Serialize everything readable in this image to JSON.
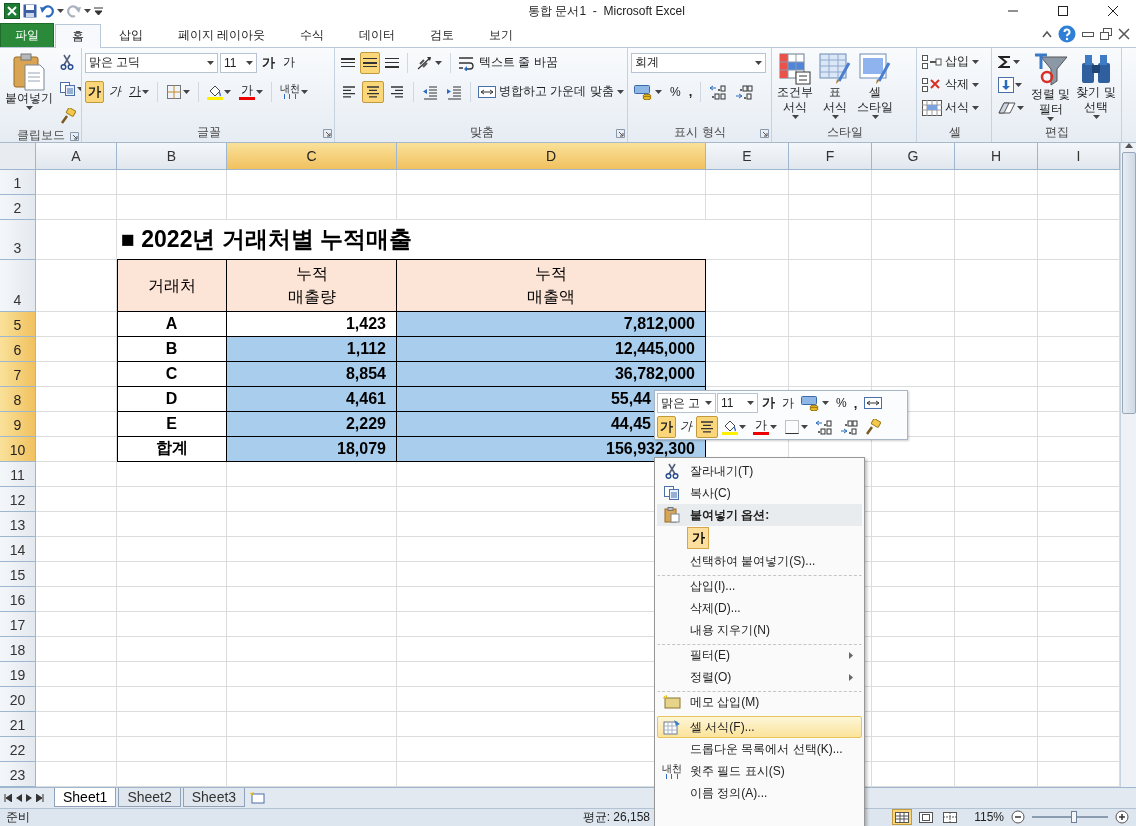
{
  "window": {
    "title": "통합 문서1  -  Microsoft Excel"
  },
  "ribbon_tabs": [
    {
      "label": "파일",
      "kind": "file",
      "selected": false
    },
    {
      "label": "홈",
      "kind": "tab",
      "selected": true
    },
    {
      "label": "삽입",
      "kind": "tab",
      "selected": false
    },
    {
      "label": "페이지 레이아웃",
      "kind": "tab",
      "selected": false
    },
    {
      "label": "수식",
      "kind": "tab",
      "selected": false
    },
    {
      "label": "데이터",
      "kind": "tab",
      "selected": false
    },
    {
      "label": "검토",
      "kind": "tab",
      "selected": false
    },
    {
      "label": "보기",
      "kind": "tab",
      "selected": false
    }
  ],
  "ribbon": {
    "clipboard": {
      "label": "클립보드",
      "paste": "붙여넣기"
    },
    "font": {
      "label": "글꼴",
      "font_name": "맑은 고딕",
      "font_size": "11",
      "grow": "가",
      "shrink": "가",
      "bold": {
        "text": "가",
        "selected": true
      },
      "italic": {
        "text": "가",
        "selected": false
      },
      "underline": {
        "text": "가",
        "selected": false
      },
      "font_color": "가",
      "phonetic": "내천"
    },
    "alignment": {
      "label": "맞춤",
      "vertical": [
        {
          "selected": false
        },
        {
          "selected": true
        },
        {
          "selected": false
        }
      ],
      "horizontal": [
        {
          "selected": false
        },
        {
          "selected": true
        },
        {
          "selected": false
        }
      ],
      "wrap_text": "텍스트 줄 바꿈",
      "merge": "병합하고 가운데 맞춤"
    },
    "number": {
      "label": "표시 형식",
      "format": "회계",
      "percent": "%",
      "comma": ","
    },
    "styles": {
      "label": "스타일",
      "buttons": [
        {
          "label": "조건부\n서식"
        },
        {
          "label": "표\n서식"
        },
        {
          "label": "셀\n스타일"
        }
      ]
    },
    "cells": {
      "label": "셀",
      "buttons": [
        {
          "label": "삽입"
        },
        {
          "label": "삭제"
        },
        {
          "label": "서식"
        }
      ]
    },
    "editing": {
      "label": "편집",
      "buttons": [
        {
          "label": "정렬 및\n필터"
        },
        {
          "label": "찾기 및\n선택"
        }
      ]
    }
  },
  "sheet": {
    "columns": [
      {
        "label": "A",
        "selected": false
      },
      {
        "label": "B",
        "selected": false
      },
      {
        "label": "C",
        "selected": true
      },
      {
        "label": "D",
        "selected": true
      },
      {
        "label": "E",
        "selected": false
      },
      {
        "label": "F",
        "selected": false
      },
      {
        "label": "G",
        "selected": false
      },
      {
        "label": "H",
        "selected": false
      },
      {
        "label": "I",
        "selected": false
      }
    ],
    "rows": [
      {
        "label": "1",
        "selected": false
      },
      {
        "label": "2",
        "selected": false
      },
      {
        "label": "3",
        "selected": false
      },
      {
        "label": "4",
        "selected": false
      },
      {
        "label": "5",
        "selected": true
      },
      {
        "label": "6",
        "selected": true
      },
      {
        "label": "7",
        "selected": true
      },
      {
        "label": "8",
        "selected": true
      },
      {
        "label": "9",
        "selected": true
      },
      {
        "label": "10",
        "selected": true
      },
      {
        "label": "11",
        "selected": false
      },
      {
        "label": "12",
        "selected": false
      },
      {
        "label": "13",
        "selected": false
      },
      {
        "label": "14",
        "selected": false
      },
      {
        "label": "15",
        "selected": false
      },
      {
        "label": "16",
        "selected": false
      },
      {
        "label": "17",
        "selected": false
      },
      {
        "label": "18",
        "selected": false
      },
      {
        "label": "19",
        "selected": false
      },
      {
        "label": "20",
        "selected": false
      },
      {
        "label": "21",
        "selected": false
      },
      {
        "label": "22",
        "selected": false
      },
      {
        "label": "23",
        "selected": false
      }
    ],
    "title": "■ 2022년 거래처별 누적매출",
    "table": {
      "header": [
        "거래처",
        "누적\n매출량",
        "누적\n매출액"
      ],
      "rows": [
        {
          "cells": [
            {
              "value": "A",
              "selected": false
            },
            {
              "value": "1,423",
              "selected": false
            },
            {
              "value": "7,812,000",
              "selected": true
            }
          ]
        },
        {
          "cells": [
            {
              "value": "B",
              "selected": false
            },
            {
              "value": "1,112",
              "selected": true
            },
            {
              "value": "12,445,000",
              "selected": true
            }
          ]
        },
        {
          "cells": [
            {
              "value": "C",
              "selected": false
            },
            {
              "value": "8,854",
              "selected": true
            },
            {
              "value": "36,782,000",
              "selected": true
            }
          ]
        },
        {
          "cells": [
            {
              "value": "D",
              "selected": false
            },
            {
              "value": "4,461",
              "selected": true
            },
            {
              "value": "55,44",
              "selected": true
            }
          ]
        },
        {
          "cells": [
            {
              "value": "E",
              "selected": false
            },
            {
              "value": "2,229",
              "selected": true
            },
            {
              "value": "44,45",
              "selected": true
            }
          ]
        },
        {
          "cells": [
            {
              "value": "합계",
              "selected": false
            },
            {
              "value": "18,079",
              "selected": true
            },
            {
              "value": "156,932,300",
              "selected": true
            }
          ]
        }
      ]
    }
  },
  "mini_toolbar": {
    "font_name": "맑은 고",
    "font_size": "11",
    "grow": "가",
    "shrink": "가",
    "percent": "%",
    "comma": ",",
    "bold": {
      "text": "가",
      "selected": true
    },
    "italic": {
      "text": "가",
      "selected": false
    },
    "center": {
      "selected": true
    },
    "font_color": "가"
  },
  "context_menu": {
    "items": [
      {
        "label": "잘라내기(T)",
        "kind": "item",
        "separator_before": false,
        "selected": false
      },
      {
        "label": "복사(C)",
        "kind": "item",
        "separator_before": false,
        "selected": false
      },
      {
        "label": "붙여넣기 옵션:",
        "kind": "header",
        "separator_before": false,
        "selected": false
      },
      {
        "label": "가",
        "kind": "paste-option",
        "separator_before": false,
        "selected": false
      },
      {
        "label": "선택하여 붙여넣기(S)...",
        "kind": "item",
        "separator_before": false,
        "selected": false
      },
      {
        "label": "삽입(I)...",
        "kind": "item",
        "separator_before": true,
        "selected": false
      },
      {
        "label": "삭제(D)...",
        "kind": "item",
        "separator_before": false,
        "selected": false
      },
      {
        "label": "내용 지우기(N)",
        "kind": "item",
        "separator_before": false,
        "selected": false
      },
      {
        "label": "필터(E)",
        "kind": "submenu",
        "separator_before": true,
        "selected": false
      },
      {
        "label": "정렬(O)",
        "kind": "submenu",
        "separator_before": false,
        "selected": false
      },
      {
        "label": "메모 삽입(M)",
        "kind": "item",
        "separator_before": true,
        "selected": false
      },
      {
        "label": "셀 서식(F)...",
        "kind": "item",
        "separator_before": true,
        "selected": true
      },
      {
        "label": "드롭다운 목록에서 선택(K)...",
        "kind": "item",
        "separator_before": false,
        "selected": false
      },
      {
        "label": "윗주 필드 표시(S)",
        "kind": "item",
        "icon_text": "내천",
        "separator_before": false,
        "selected": false
      },
      {
        "label": "이름 정의(A)...",
        "kind": "item",
        "separator_before": false,
        "selected": false
      }
    ]
  },
  "sheet_tabs": [
    {
      "label": "Sheet1",
      "selected": true
    },
    {
      "label": "Sheet2",
      "selected": false
    },
    {
      "label": "Sheet3",
      "selected": false
    }
  ],
  "status_bar": {
    "ready": "준비",
    "average": "평균: 26,158",
    "views": [
      {
        "selected": true
      },
      {
        "selected": false
      },
      {
        "selected": false
      }
    ],
    "zoom": "115%",
    "zoom_slider": {
      "level": 0.55
    }
  }
}
